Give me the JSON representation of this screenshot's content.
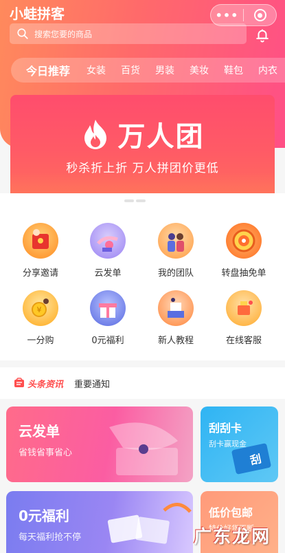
{
  "app": {
    "title": "小蛙拼客",
    "more_label": "•••"
  },
  "search": {
    "placeholder": "搜索您要的商品"
  },
  "tabs": [
    {
      "label": "今日推荐",
      "active": true
    },
    {
      "label": "女装"
    },
    {
      "label": "百货"
    },
    {
      "label": "男装"
    },
    {
      "label": "美妆"
    },
    {
      "label": "鞋包"
    },
    {
      "label": "内衣"
    }
  ],
  "banner": {
    "title": "万人团",
    "subtitle": "秒杀折上折 万人拼团价更低"
  },
  "grid": [
    {
      "label": "分享邀请",
      "icon": "red-envelope-icon",
      "color": "#ff9f3a"
    },
    {
      "label": "云发单",
      "icon": "cloud-send-icon",
      "color": "#a995f5"
    },
    {
      "label": "我的团队",
      "icon": "team-icon",
      "color": "#ffab5c"
    },
    {
      "label": "转盘抽免单",
      "icon": "wheel-icon",
      "color": "#ff8a3d"
    },
    {
      "label": "一分购",
      "icon": "coin-icon",
      "color": "#ffb83c"
    },
    {
      "label": "0元福利",
      "icon": "gift-box-icon",
      "color": "#7a8df0"
    },
    {
      "label": "新人教程",
      "icon": "tutorial-icon",
      "color": "#ff9a5a"
    },
    {
      "label": "在线客服",
      "icon": "customer-service-icon",
      "color": "#ffb74a"
    }
  ],
  "news": {
    "tag": "头条资讯",
    "text": "重要通知"
  },
  "cards": [
    {
      "title": "云发单",
      "subtitle": "省钱省事省心"
    },
    {
      "title": "刮刮卡",
      "subtitle": "刮卡赢现金"
    },
    {
      "title": "0元福利",
      "subtitle": "每天福利抢不停"
    },
    {
      "title": "低价包邮",
      "subtitle": "特价好货不断"
    }
  ],
  "watermark": "广东龙网"
}
